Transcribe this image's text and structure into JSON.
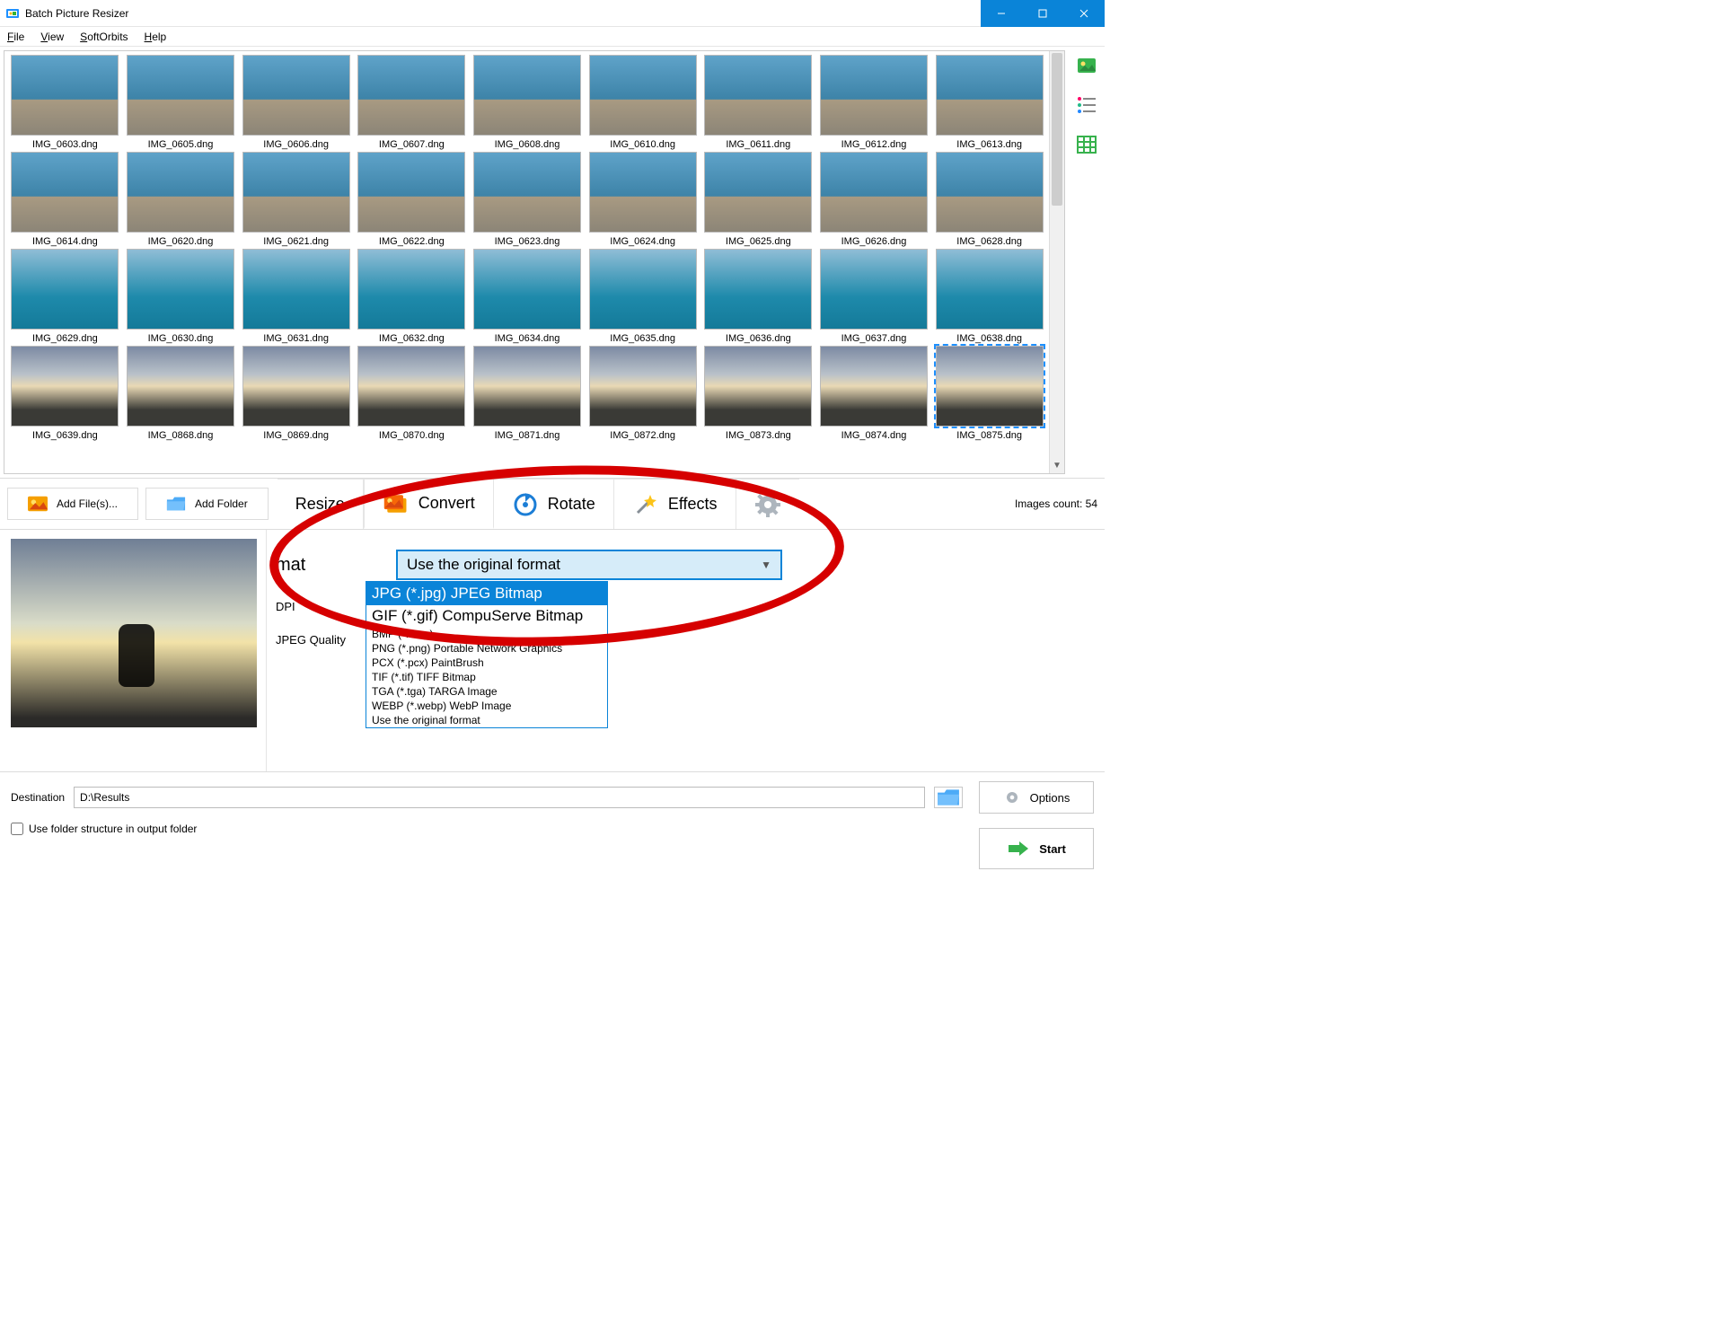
{
  "app": {
    "title": "Batch Picture Resizer"
  },
  "menu": {
    "file": "File",
    "view": "View",
    "softorbits": "SoftOrbits",
    "help": "Help"
  },
  "thumbs": [
    "IMG_0603.dng",
    "IMG_0605.dng",
    "IMG_0606.dng",
    "IMG_0607.dng",
    "IMG_0608.dng",
    "IMG_0610.dng",
    "IMG_0611.dng",
    "IMG_0612.dng",
    "IMG_0613.dng",
    "IMG_0614.dng",
    "IMG_0620.dng",
    "IMG_0621.dng",
    "IMG_0622.dng",
    "IMG_0623.dng",
    "IMG_0624.dng",
    "IMG_0625.dng",
    "IMG_0626.dng",
    "IMG_0628.dng",
    "IMG_0629.dng",
    "IMG_0630.dng",
    "IMG_0631.dng",
    "IMG_0632.dng",
    "IMG_0634.dng",
    "IMG_0635.dng",
    "IMG_0636.dng",
    "IMG_0637.dng",
    "IMG_0638.dng",
    "IMG_0639.dng",
    "IMG_0868.dng",
    "IMG_0869.dng",
    "IMG_0870.dng",
    "IMG_0871.dng",
    "IMG_0872.dng",
    "IMG_0873.dng",
    "IMG_0874.dng",
    "IMG_0875.dng"
  ],
  "selected_index": 35,
  "buttons": {
    "add_files": "Add File(s)...",
    "add_folder": "Add Folder"
  },
  "tabs": {
    "resize": "Resize",
    "convert": "Convert",
    "rotate": "Rotate",
    "effects": "Effects"
  },
  "images_count_label": "Images count: 54",
  "settings": {
    "format_label": "mat",
    "dpi_label": "DPI",
    "quality_label": "JPEG Quality",
    "combo_value": "Use the original format",
    "options": [
      "JPG (*.jpg) JPEG Bitmap",
      "GIF (*.gif) CompuServe Bitmap",
      "BMP (*.bmp)",
      "PNG (*.png) Portable Network Graphics",
      "PCX (*.pcx) PaintBrush",
      "TIF (*.tif) TIFF Bitmap",
      "TGA (*.tga) TARGA Image",
      "WEBP (*.webp) WebP Image",
      "Use the original format"
    ]
  },
  "footer": {
    "destination_label": "Destination",
    "destination_value": "D:\\Results",
    "use_folder_structure": "Use folder structure in output folder",
    "options_btn": "Options",
    "start_btn": "Start"
  }
}
